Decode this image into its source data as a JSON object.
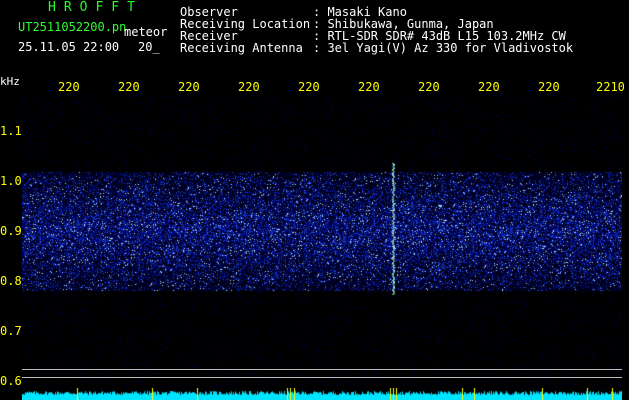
{
  "header": {
    "brand": "HROFFT",
    "filename": "UT2511052200.pn",
    "mode": "meteor",
    "datetime": "25.11.05 22:00",
    "minute": "20_"
  },
  "info": {
    "labels": [
      "Observer",
      "Receiving Location",
      "Receiver",
      "Receiving Antenna"
    ],
    "values": [
      ": Masaki Kano",
      ": Shibukawa, Gunma, Japan",
      ": RTL-SDR SDR# 43dB L15 103.2MHz CW",
      ": 3el Yagi(V) Az 330 for Vladivostok"
    ]
  },
  "axis": {
    "unit": "kHz",
    "x_labels": [
      "220",
      "220",
      "220",
      "220",
      "220",
      "220",
      "220",
      "220",
      "220",
      "2210"
    ],
    "y_labels": [
      "1.1",
      "1.0",
      "0.9",
      "0.8",
      "0.7",
      "0.6"
    ]
  },
  "colors": {
    "background": "#000000",
    "text_white": "#ffffff",
    "text_yellow": "#ffff00",
    "brand_green": "#22ff22",
    "noise_blue": "#1030c0",
    "strip_cyan": "#00e5ff"
  }
}
